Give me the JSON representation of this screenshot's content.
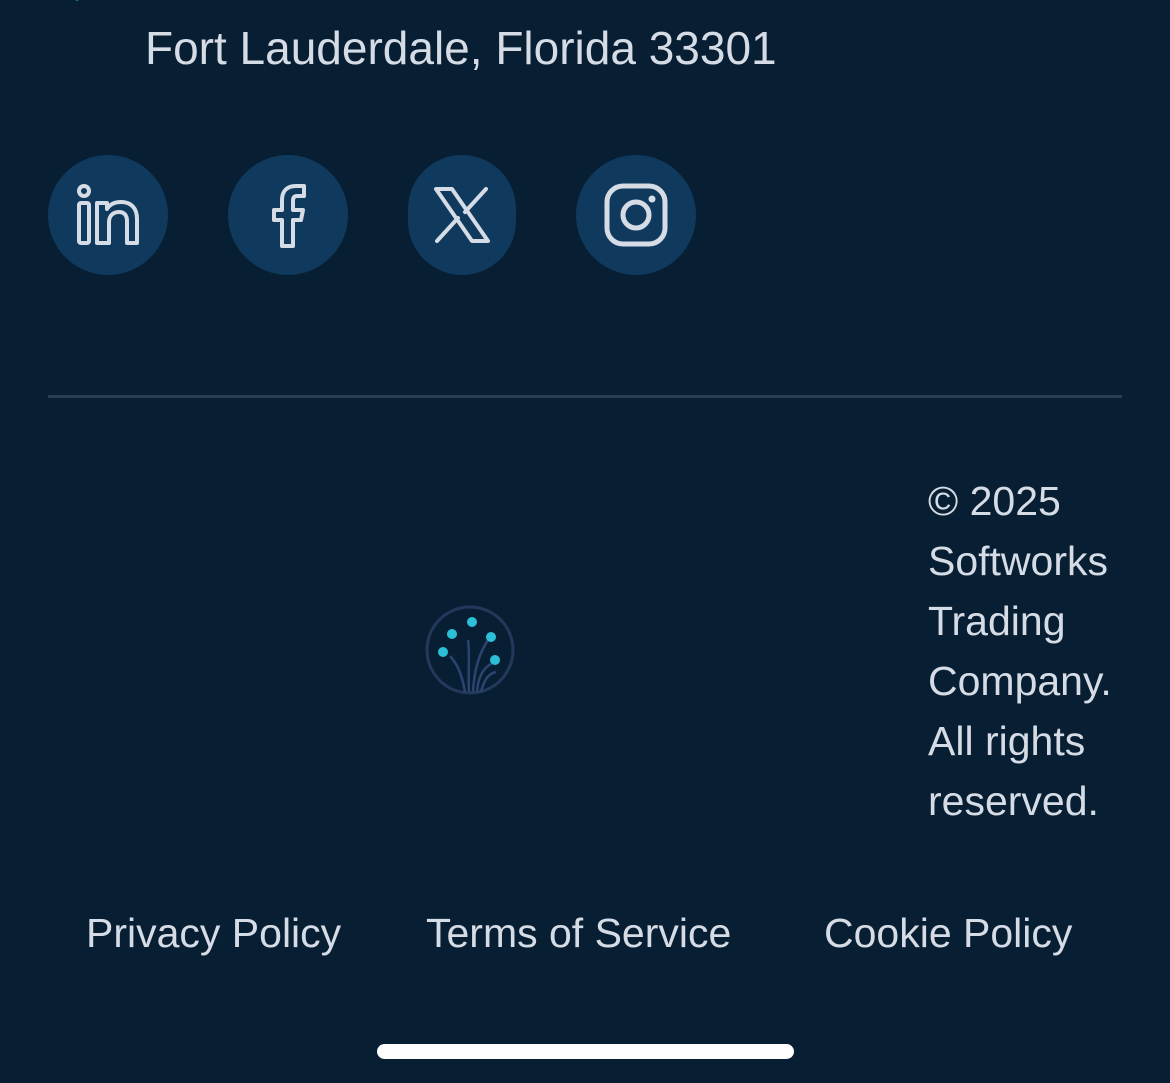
{
  "footer": {
    "address_line": "Fort Lauderdale, Florida 33301",
    "social": [
      {
        "name": "LinkedIn",
        "icon": "linkedin-icon"
      },
      {
        "name": "Facebook",
        "icon": "facebook-icon"
      },
      {
        "name": "X",
        "icon": "x-icon"
      },
      {
        "name": "Instagram",
        "icon": "instagram-icon"
      }
    ],
    "copyright_lines": [
      "© 2025",
      "Softworks",
      "Trading",
      "Company.",
      "All rights",
      "reserved."
    ],
    "legal_links": {
      "privacy": "Privacy Policy",
      "terms": "Terms of Service",
      "cookie": "Cookie Policy"
    }
  },
  "colors": {
    "background": "#081f33",
    "social_button_bg": "#0f3a5d",
    "icon_stroke": "#d5dce6",
    "accent": "#2bc0d8",
    "text": "#d5dce6"
  }
}
